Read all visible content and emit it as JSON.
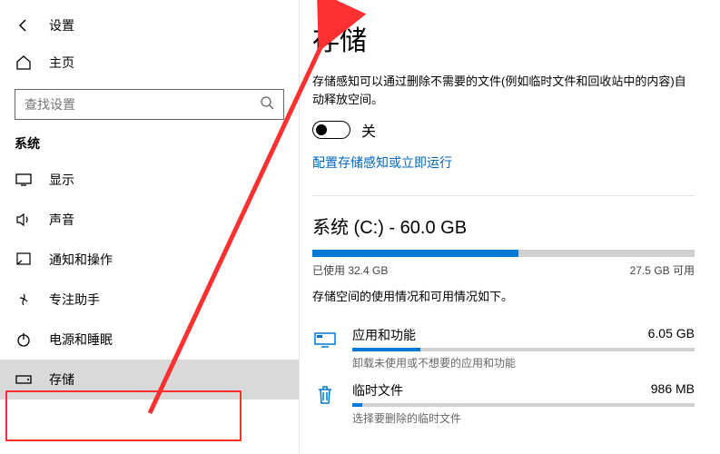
{
  "header": {
    "title": "设置"
  },
  "home": {
    "label": "主页"
  },
  "search": {
    "placeholder": "查找设置"
  },
  "section": "系统",
  "nav": [
    {
      "label": "显示"
    },
    {
      "label": "声音"
    },
    {
      "label": "通知和操作"
    },
    {
      "label": "专注助手"
    },
    {
      "label": "电源和睡眠"
    },
    {
      "label": "存储"
    }
  ],
  "page": {
    "heading": "存储",
    "sense_desc": "存储感知可以通过删除不需要的文件(例如临时文件和回收站中的内容)自动释放空间。",
    "toggle_label": "关",
    "config_link": "配置存储感知或立即运行",
    "drive_title": "系统 (C:) - 60.0 GB",
    "used_label": "已使用 32.4 GB",
    "free_label": "27.5 GB 可用",
    "usage_percent": 54,
    "breakdown_desc": "存储空间的使用情况和可用情况如下。",
    "categories": [
      {
        "name": "应用和功能",
        "size": "6.05 GB",
        "percent": 20,
        "sub": "卸载未使用或不想要的应用和功能"
      },
      {
        "name": "临时文件",
        "size": "986 MB",
        "percent": 3,
        "sub": "选择要删除的临时文件"
      }
    ]
  }
}
